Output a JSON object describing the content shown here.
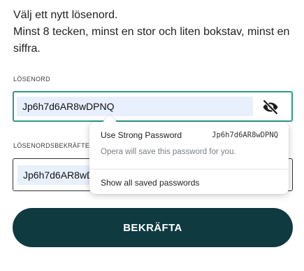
{
  "intro": {
    "line1": "Välj ett nytt lösenord.",
    "line2": "Minst 8 tecken, minst en stor och liten bokstav, minst en",
    "line3": "siffra."
  },
  "password": {
    "label": "LÖSENORD",
    "value": "Jp6h7d6AR8wDPNQ",
    "toggle_icon": "eye-slash-icon"
  },
  "confirm_password": {
    "label": "LÖSENORDSBEKRÄFTELSE",
    "value": "Jp6h7d6AR8wDPNQ"
  },
  "autofill_popup": {
    "suggest_title": "Use Strong Password",
    "suggested_password": "Jp6h7d6AR8wDPNQ",
    "note": "Opera will save this password for you.",
    "show_all": "Show all saved passwords"
  },
  "submit": {
    "label": "BEKRÄFTA",
    "color": "#0e3a40"
  },
  "colors": {
    "focus_border": "#2f9b87",
    "autofill_bg": "#e8f0fe"
  }
}
